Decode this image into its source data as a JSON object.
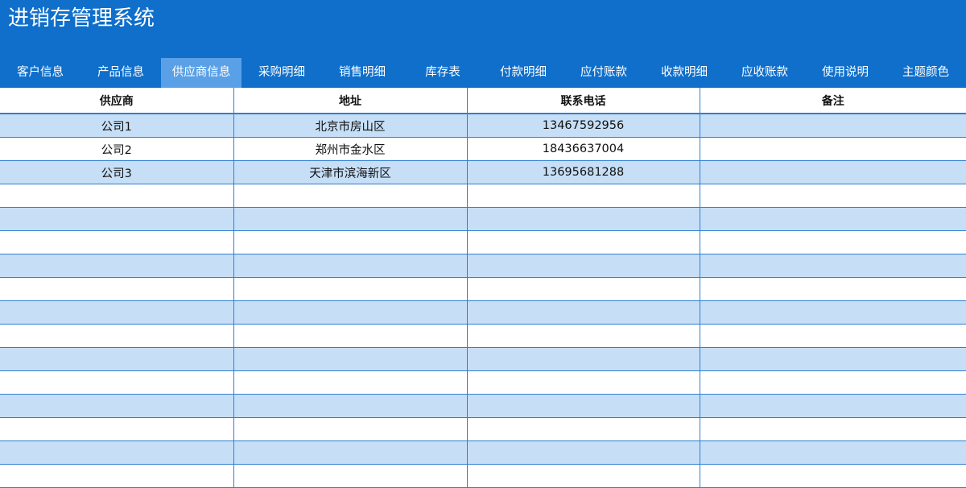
{
  "app": {
    "title": "进销存管理系统"
  },
  "tabs": [
    {
      "label": "客户信息"
    },
    {
      "label": "产品信息"
    },
    {
      "label": "供应商信息",
      "active": true
    },
    {
      "label": "采购明细"
    },
    {
      "label": "销售明细"
    },
    {
      "label": "库存表"
    },
    {
      "label": "付款明细"
    },
    {
      "label": "应付账款"
    },
    {
      "label": "收款明细"
    },
    {
      "label": "应收账款"
    },
    {
      "label": "使用说明"
    },
    {
      "label": "主题颜色"
    }
  ],
  "table": {
    "columns": [
      "供应商",
      "地址",
      "联系电话",
      "备注"
    ],
    "rows": [
      [
        "公司1",
        "北京市房山区",
        "13467592956",
        ""
      ],
      [
        "公司2",
        "郑州市金水区",
        "18436637004",
        ""
      ],
      [
        "公司3",
        "天津市滨海新区",
        "13695681288",
        ""
      ],
      [
        "",
        "",
        "",
        ""
      ],
      [
        "",
        "",
        "",
        ""
      ],
      [
        "",
        "",
        "",
        ""
      ],
      [
        "",
        "",
        "",
        ""
      ],
      [
        "",
        "",
        "",
        ""
      ],
      [
        "",
        "",
        "",
        ""
      ],
      [
        "",
        "",
        "",
        ""
      ],
      [
        "",
        "",
        "",
        ""
      ],
      [
        "",
        "",
        "",
        ""
      ],
      [
        "",
        "",
        "",
        ""
      ],
      [
        "",
        "",
        "",
        ""
      ],
      [
        "",
        "",
        "",
        ""
      ],
      [
        "",
        "",
        "",
        ""
      ]
    ]
  },
  "colors": {
    "header_bg": "#0f6fcb",
    "active_tab_bg": "#5aa0e6",
    "row_stripe": "#c6dff7",
    "grid_line": "#2f7fd0"
  }
}
